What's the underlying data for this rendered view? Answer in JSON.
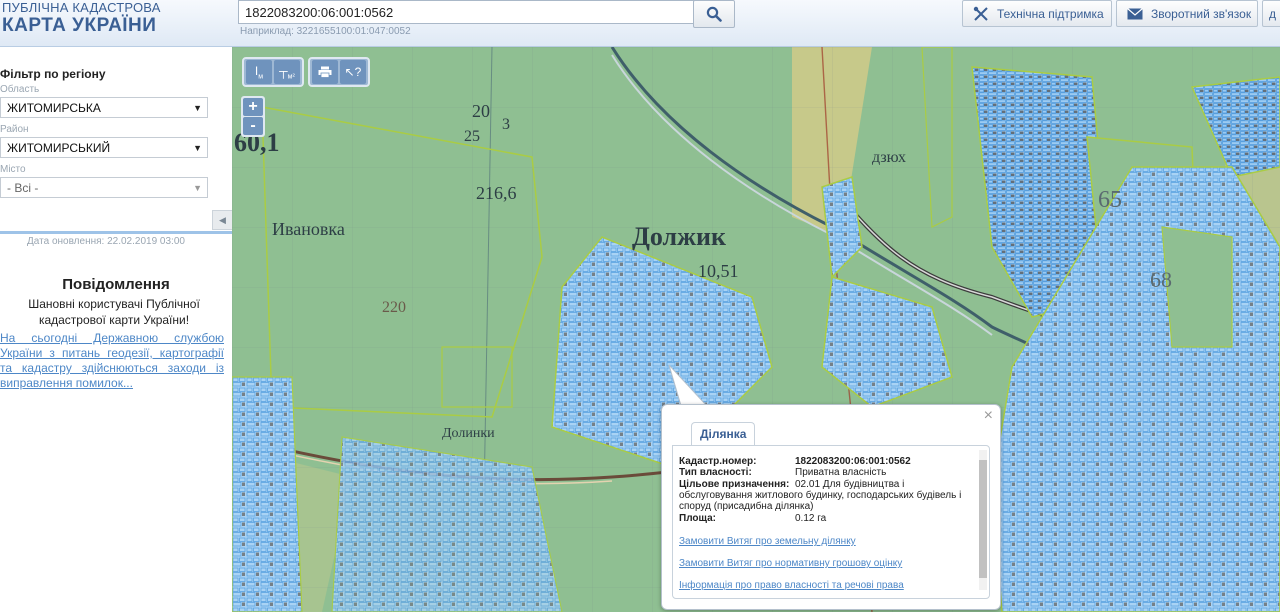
{
  "header": {
    "logo_line1": "ПУБЛІЧНА КАДАСТРОВА",
    "logo_line2": "КАРТА УКРАЇНИ",
    "search_value": "1822083200:06:001:0562",
    "search_hint": "Наприклад: 3221655100:01:047:0052",
    "support_label": "Технічна підтримка",
    "feedback_label": "Зворотний зв'язок",
    "extra_label": "д"
  },
  "sidebar": {
    "filter_title": "Фільтр по регіону",
    "region_label": "Область",
    "region_value": "ЖИТОМИРСЬКА",
    "district_label": "Район",
    "district_value": "ЖИТОМИРСЬКИЙ",
    "city_label": "Місто",
    "city_value": "- Всі -",
    "updated": "Дата оновлення: 22.02.2019 03:00",
    "notice_title": "Повідомлення",
    "notice_text": "Шановні користувачі Публічної кадастрової карти України!",
    "notice_link": "На сьогодні Державною службою України з питань геодезії, картографії та кадастру здійснюються заходи із виправлення помилок..."
  },
  "map": {
    "labels": [
      "Должик",
      "Ивановка",
      "216,6",
      "10,51",
      "220",
      "65",
      "68",
      "20",
      "25",
      "3",
      "60,1",
      "дзюх",
      "Долинки"
    ],
    "zoom_in": "+",
    "zoom_out": "-"
  },
  "popup": {
    "tab": "Ділянка",
    "rows": [
      {
        "key": "Кадастр.номер:",
        "value": "1822083200:06:001:0562"
      },
      {
        "key": "Тип власності:",
        "value": "Приватна власність"
      },
      {
        "key": "Цільове призначення:",
        "value": "02.01 Для будівництва і обслуговування житлового будинку, господарських будівель і споруд (присадибна ділянка)"
      },
      {
        "key": "Площа:",
        "value": "0.12 га"
      }
    ],
    "links": [
      "Замовити Витяг про земельну ділянку",
      "Замовити Витяг про нормативну грошову оцінку",
      "Інформація про право власності та речові права"
    ]
  },
  "colors": {
    "brand": "#3a5f94",
    "link": "#4d87c7",
    "parcel_fill": "#a9d3f5",
    "parcel_border": "#aacc44",
    "map_green": "#8fbf92"
  }
}
